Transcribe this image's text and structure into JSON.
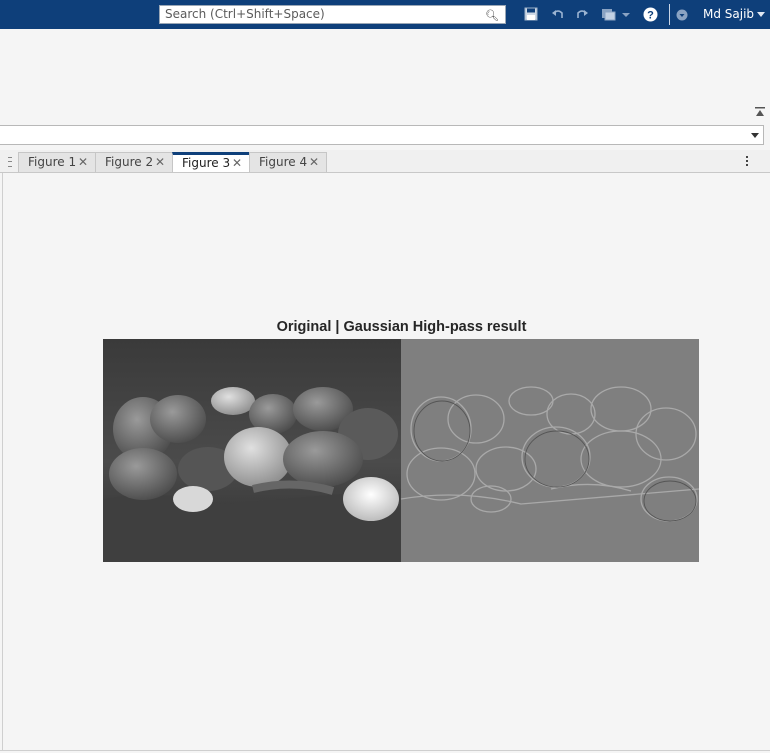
{
  "search": {
    "placeholder": "Search (Ctrl+Shift+Space)"
  },
  "user": {
    "name": "Md Sajib"
  },
  "toolbar_icons": [
    "save-icon",
    "undo-icon",
    "redo-icon",
    "window-switch-icon",
    "help-icon",
    "notification-icon"
  ],
  "tabs": [
    {
      "label": "Figure 1",
      "active": false
    },
    {
      "label": "Figure 2",
      "active": false
    },
    {
      "label": "Figure 3",
      "active": true
    },
    {
      "label": "Figure 4",
      "active": false
    }
  ],
  "figure": {
    "title": "Original | Gaussian High-pass result",
    "panels": [
      "original-grayscale-peppers",
      "gaussian-highpass-peppers"
    ]
  },
  "colors": {
    "topbar": "#0e3f7a",
    "active_tab_accent": "#0e3f7a",
    "background": "#f5f5f5"
  }
}
